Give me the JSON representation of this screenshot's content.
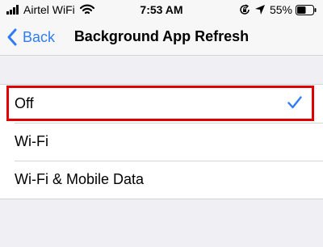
{
  "status_bar": {
    "carrier": "Airtel WiFi",
    "time": "7:53 AM",
    "battery": "55%",
    "battery_level": 0.55,
    "icons": [
      "signal-bars-icon",
      "wifi-icon",
      "rotation-lock-icon",
      "location-icon",
      "battery-icon"
    ]
  },
  "nav": {
    "back_label": "Back",
    "title": "Background App Refresh"
  },
  "options": [
    {
      "label": "Off",
      "selected": true
    },
    {
      "label": "Wi-Fi",
      "selected": false
    },
    {
      "label": "Wi-Fi & Mobile Data",
      "selected": false
    }
  ],
  "colors": {
    "accent": "#2f7cf6",
    "highlight": "#e00000",
    "background": "#efeff4"
  }
}
